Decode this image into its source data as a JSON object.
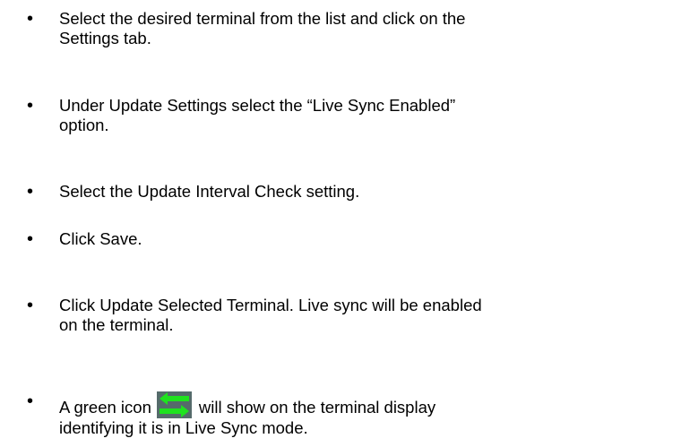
{
  "bullet_glyph": "•",
  "steps": [
    {
      "text": "Select the desired terminal from the list and click on the\nSettings tab."
    },
    {
      "text": "Under Update Settings select the “Live Sync Enabled”\noption."
    },
    {
      "text": "Select the Update Interval Check setting."
    },
    {
      "text": "Click Save."
    },
    {
      "text": "Click Update Selected Terminal. Live sync will be enabled\non the terminal."
    },
    {
      "text_before_icon": "A green icon",
      "text_after_icon": "will show on the terminal display",
      "text_line2": "identifying it is in Live Sync mode.",
      "icon": "live-sync-arrows",
      "icon_color": "#1fe21f",
      "icon_bg": "#556b6b"
    }
  ]
}
